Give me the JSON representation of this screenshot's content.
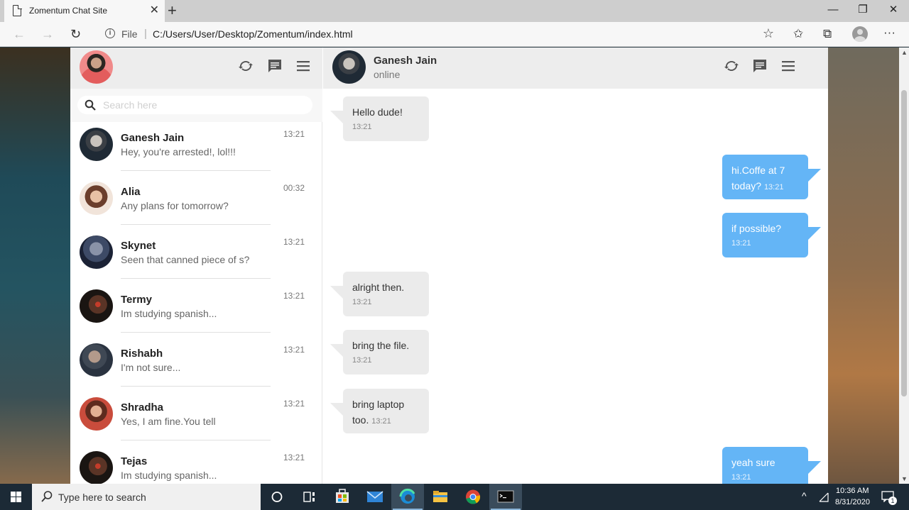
{
  "browser": {
    "tab_title": "Zomentum Chat Site",
    "tab_close": "✕",
    "new_tab": "+",
    "window_min": "—",
    "window_restore": "❐",
    "window_close": "✕",
    "nav_back": "←",
    "nav_forward": "→",
    "reload": "↻",
    "info": "i",
    "url_scheme_label": "File",
    "url_separator": "|",
    "url": "C:/Users/User/Desktop/Zomentum/index.html",
    "more": "···"
  },
  "sidebar": {
    "search_placeholder": "Search here",
    "chats": [
      {
        "name": "Ganesh Jain",
        "preview": "Hey, you're arrested!, lol!!!",
        "time": "13:21"
      },
      {
        "name": "Alia",
        "preview": "Any plans for tomorrow?",
        "time": "00:32"
      },
      {
        "name": "Skynet",
        "preview": "Seen that canned piece of s?",
        "time": "13:21"
      },
      {
        "name": "Termy",
        "preview": "Im studying spanish...",
        "time": "13:21"
      },
      {
        "name": "Rishabh",
        "preview": "I'm not sure...",
        "time": "13:21"
      },
      {
        "name": "Shradha",
        "preview": "Yes, I am fine.You tell",
        "time": "13:21"
      },
      {
        "name": "Tejas",
        "preview": "Im studying spanish...",
        "time": "13:21"
      }
    ]
  },
  "chat": {
    "peer_name": "Ganesh Jain",
    "peer_status": "online",
    "messages": [
      {
        "dir": "in",
        "text": "Hello dude!",
        "time": "13:21"
      },
      {
        "dir": "out",
        "text_line1": "hi.Coffe at 7",
        "text_line2": "today?",
        "time": "13:21"
      },
      {
        "dir": "out",
        "text": "if possible?",
        "time": "13:21"
      },
      {
        "dir": "in",
        "text": "alright then.",
        "time": "13:21"
      },
      {
        "dir": "in",
        "text": "bring the file.",
        "time": "13:21"
      },
      {
        "dir": "in",
        "text_line1": "bring laptop",
        "text_line2": "too.",
        "time": "13:21"
      },
      {
        "dir": "out",
        "text": "yeah sure",
        "time": "13:21"
      }
    ]
  },
  "taskbar": {
    "search_placeholder": "Type here to search",
    "time": "10:36 AM",
    "date": "8/31/2020",
    "notification_count": "1"
  },
  "colors": {
    "outgoing_bubble": "#64b5f6",
    "incoming_bubble": "#ebebeb",
    "header_bg": "#ededed"
  }
}
